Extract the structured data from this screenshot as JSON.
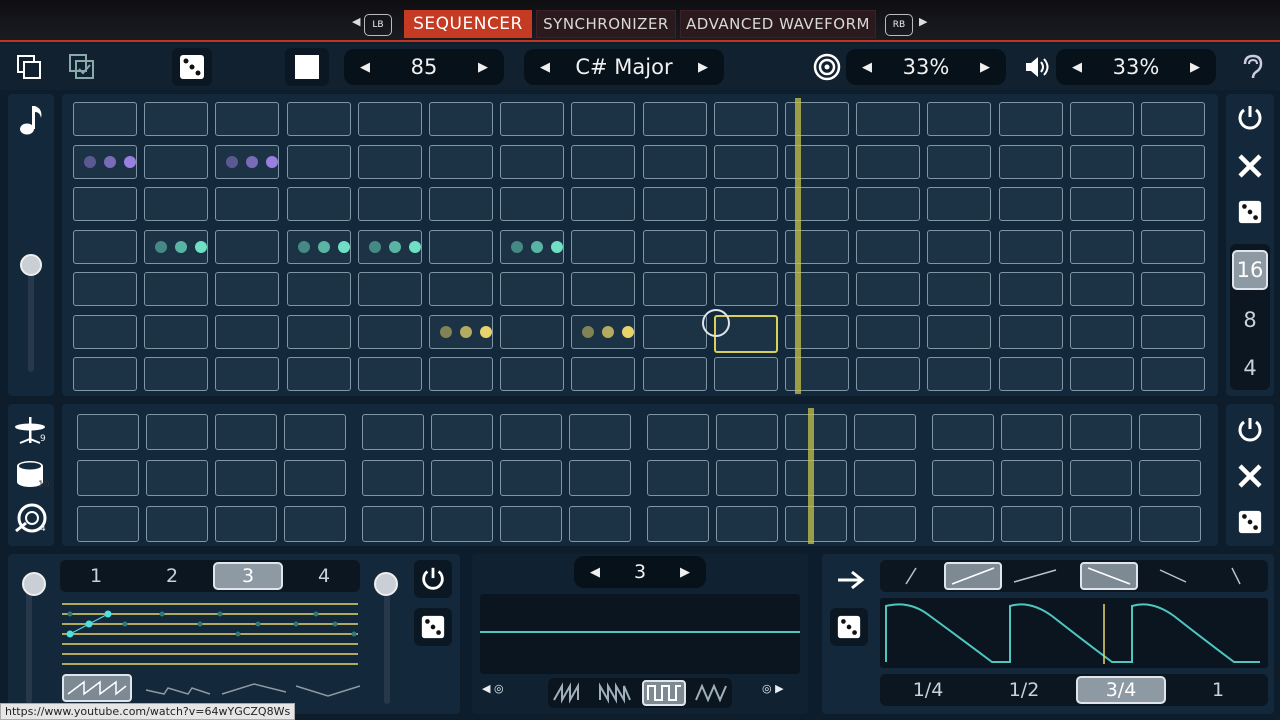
{
  "tabs": {
    "left_pad": "LB",
    "right_pad": "RB",
    "items": [
      "SEQUENCER",
      "SYNCHRONIZER",
      "ADVANCED WAVEFORM"
    ]
  },
  "toolbar": {
    "tempo": "85",
    "scale": "C# Major",
    "target_percent": "33%",
    "volume_percent": "33%"
  },
  "step_lengths": [
    "16",
    "8",
    "4"
  ],
  "selected_step_length": "16",
  "pattern_tabs": [
    "1",
    "2",
    "3",
    "4"
  ],
  "selected_pattern": "3",
  "waveform_selector": "3",
  "rate_options": [
    "1/4",
    "1/2",
    "3/4",
    "1"
  ],
  "selected_rate": "3/4",
  "drum_badges": [
    "9",
    "10",
    "4"
  ],
  "status_url": "https://www.youtube.com/watch?v=64wYGCZQ8Ws",
  "colors": {
    "accent_red": "#c53a22",
    "purple_dot": "#9b7fe0",
    "teal_dot": "#6fe0c4",
    "yellow_dot": "#e8d46a",
    "playhead": "#c8c24a",
    "lfo_wave": "#4fc7c0"
  }
}
